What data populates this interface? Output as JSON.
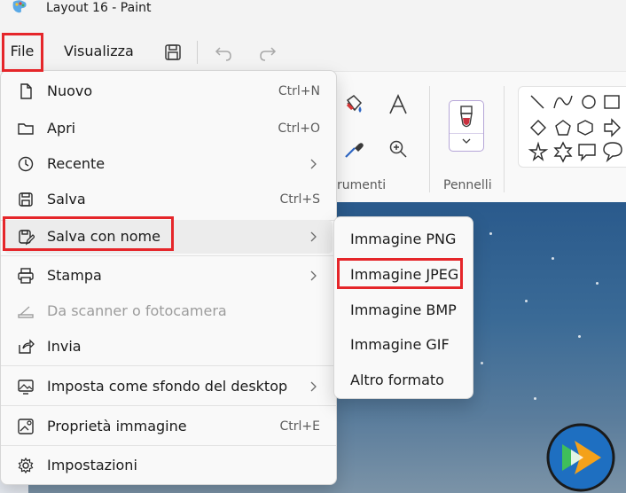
{
  "window": {
    "title": "Layout 16 - Paint",
    "app_icon": "palette-icon"
  },
  "menubar": {
    "file_label": "File",
    "view_label": "Visualizza",
    "icons": [
      "save-icon",
      "undo-icon",
      "redo-icon"
    ]
  },
  "ribbon": {
    "tools_label": "rumenti",
    "brushes_label": "Pennelli",
    "tool_icons": [
      "fill-bucket-icon",
      "text-icon",
      "color-picker-icon",
      "magnifier-icon"
    ],
    "shape_icons": [
      "line-icon",
      "curve-icon",
      "oval-icon",
      "rectangle-icon",
      "diamond-icon",
      "pentagon-icon",
      "hexagon-icon",
      "arrow-right-icon",
      "star4-icon",
      "star6-icon",
      "callout-rect-icon",
      "callout-oval-icon"
    ]
  },
  "file_menu": {
    "items": [
      {
        "label": "Nuovo",
        "shortcut": "Ctrl+N",
        "icon": "new-file-icon"
      },
      {
        "label": "Apri",
        "shortcut": "Ctrl+O",
        "icon": "folder-icon"
      },
      {
        "label": "Recente",
        "shortcut": "",
        "icon": "clock-icon",
        "submenu": true
      },
      {
        "label": "Salva",
        "shortcut": "Ctrl+S",
        "icon": "save-icon"
      },
      {
        "label": "Salva con nome",
        "shortcut": "",
        "icon": "save-as-icon",
        "submenu": true,
        "active": true
      },
      {
        "label": "Stampa",
        "shortcut": "",
        "icon": "printer-icon",
        "submenu": true
      },
      {
        "label": "Da scanner o fotocamera",
        "shortcut": "",
        "icon": "scanner-icon",
        "disabled": true
      },
      {
        "label": "Invia",
        "shortcut": "",
        "icon": "share-icon"
      },
      {
        "label": "Imposta come sfondo del desktop",
        "shortcut": "",
        "icon": "desktop-icon",
        "submenu": true
      },
      {
        "label": "Proprietà immagine",
        "shortcut": "Ctrl+E",
        "icon": "image-properties-icon"
      },
      {
        "label": "Impostazioni",
        "shortcut": "",
        "icon": "gear-icon"
      }
    ]
  },
  "save_as_submenu": {
    "items": [
      {
        "label": "Immagine PNG"
      },
      {
        "label": "Immagine JPEG",
        "highlighted": true
      },
      {
        "label": "Immagine BMP"
      },
      {
        "label": "Immagine GIF"
      },
      {
        "label": "Altro formato"
      }
    ]
  },
  "colors": {
    "highlight_red": "#e5262a",
    "menu_bg": "#f9f9f9",
    "canvas_sky": "#2a5a8c"
  }
}
